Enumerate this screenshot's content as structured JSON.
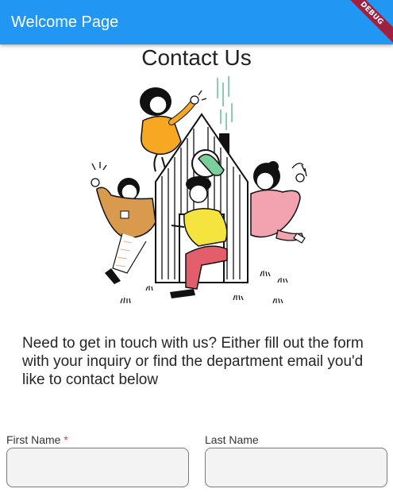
{
  "appbar": {
    "title": "Welcome Page",
    "debug_label": "DEBUG",
    "color": "#2196F3"
  },
  "page": {
    "title": "Contact Us",
    "intro": "Need to get in touch with us? Either fill out the form with your inquiry or find the department email you'd like to contact below"
  },
  "illustration": {
    "icon": "people-around-house-illustration"
  },
  "form": {
    "first_name": {
      "label": "First Name",
      "required_marker": "*",
      "value": "",
      "placeholder": ""
    },
    "last_name": {
      "label": "Last Name",
      "value": "",
      "placeholder": ""
    }
  }
}
